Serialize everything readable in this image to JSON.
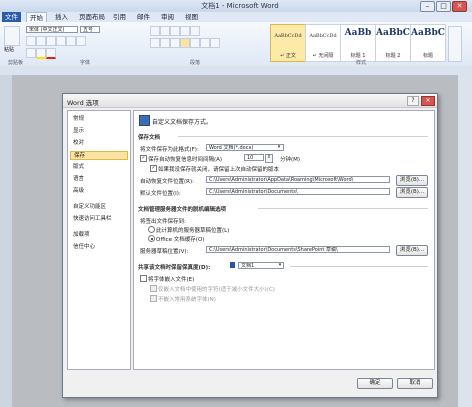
{
  "app": {
    "title": "文档1 - Microsoft Word",
    "min": "–",
    "max": "□",
    "close": "✕"
  },
  "ribbon": {
    "tabs": [
      "文件",
      "开始",
      "插入",
      "页面布局",
      "引用",
      "邮件",
      "审阅",
      "视图"
    ],
    "font_name": "宋体 (中文正文)",
    "font_size": "五号",
    "paste_label": "粘贴",
    "styles": [
      {
        "sample": "AaBbCcDd",
        "name": "↵ 正文",
        "small": true
      },
      {
        "sample": "AaBbCcDd",
        "name": "↵ 无间隔",
        "small": true
      },
      {
        "sample": "AaBb",
        "name": "标题 1",
        "small": false
      },
      {
        "sample": "AaBbC",
        "name": "标题 2",
        "small": false
      },
      {
        "sample": "AaBbC",
        "name": "标题",
        "small": false
      }
    ],
    "groups": [
      "剪贴板",
      "字体",
      "段落",
      "样式"
    ]
  },
  "dialog": {
    "title": "Word 选项",
    "help": "?",
    "close": "✕",
    "nav": [
      "常规",
      "显示",
      "校对",
      "保存",
      "版式",
      "语言",
      "高级",
      "自定义功能区",
      "快速访问工具栏",
      "加载项",
      "信任中心"
    ],
    "nav_selected_index": 3,
    "header": "自定义文档保存方式。",
    "sec_save": "保存文档",
    "format_label": "将文件保存为此格式(F):",
    "format_value": "Word 文档(*.docx)",
    "autorecover_label": "保存自动恢复信息时间间隔(A)",
    "autorecover_minutes": "10",
    "minutes_unit": "分钟(M)",
    "keep_last_label": "如果我没保存就关闭，请保留上次自动保留的版本",
    "autorecover_loc_label": "自动恢复文件位置(R):",
    "autorecover_loc_value": "C:\\Users\\Administrator\\AppData\\Roaming\\Microsoft\\Word\\",
    "default_loc_label": "默认文件位置(I):",
    "default_loc_value": "C:\\Users\\Administrator\\Documents\\",
    "browse1": "浏览(B)...",
    "browse2": "浏览(B)...",
    "sec_server": "文档管理服务器文件的脱机编辑选项",
    "checkout_label": "将签出文件保存到:",
    "radio1": "此计算机的服务器草稿位置(L)",
    "radio2": "Office 文档缓存(O)",
    "server_drafts_label": "服务器草稿位置(V):",
    "server_drafts_value": "C:\\Users\\Administrator\\Documents\\SharePoint 草稿\\",
    "browse3": "浏览(B)...",
    "sec_fidelity": "共享该文档时保留保真度(D):",
    "doc_name": "文档1",
    "embed_fonts_label": "将字体嵌入文件(E)",
    "embed_only_used": "仅嵌入文档中使用的字符(适于减小文件大小)(C)",
    "no_common_fonts": "不嵌入常用系统字体(N)",
    "ok": "确定",
    "cancel": "取消"
  }
}
